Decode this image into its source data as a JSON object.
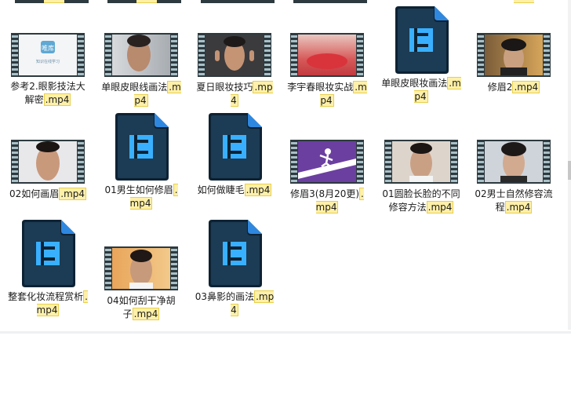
{
  "files": [
    {
      "name": "参考2.眼影技法大解密",
      "ext": ".mp4",
      "thumb": "weipu-logo"
    },
    {
      "name": "单眼皮眼线画法",
      "ext": ".mp4",
      "thumb": "man-face"
    },
    {
      "name": "夏日眼妆技巧",
      "ext": ".mp4",
      "thumb": "man-gesture"
    },
    {
      "name": "李宇春眼妆实战",
      "ext": ".mp4",
      "thumb": "red-lips"
    },
    {
      "name": "单眼皮眼妆画法",
      "ext": ".mp4",
      "thumb": "video-file-icon"
    },
    {
      "name": "修眉2",
      "ext": ".mp4",
      "thumb": "man-face-2"
    },
    {
      "name": "02如何画眉",
      "ext": ".mp4",
      "thumb": "man-closeup"
    },
    {
      "name": "01男生如何修眉",
      "ext": ".mp4",
      "thumb": "video-file-icon"
    },
    {
      "name": "如何做睫毛",
      "ext": ".mp4",
      "thumb": "video-file-icon"
    },
    {
      "name": "修眉3(8月20更)",
      "ext": ".mp4",
      "thumb": "purple-skater"
    },
    {
      "name": "01圆脸长脸的不同修容方法",
      "ext": ".mp4",
      "thumb": "man-smile"
    },
    {
      "name": "02男士自然修容流程",
      "ext": ".mp4",
      "thumb": "man-face-3"
    },
    {
      "name": "整套化妆流程赏析",
      "ext": ".mp4",
      "thumb": "video-file-icon"
    },
    {
      "name": "04如何刮干净胡子",
      "ext": ".mp4",
      "thumb": "man-closeup-2"
    },
    {
      "name": "03鼻影的画法",
      "ext": ".mp4",
      "thumb": "video-file-icon"
    }
  ],
  "weipu_logo_text": "唯库",
  "weipu_logo_sub": "知识在线学习"
}
